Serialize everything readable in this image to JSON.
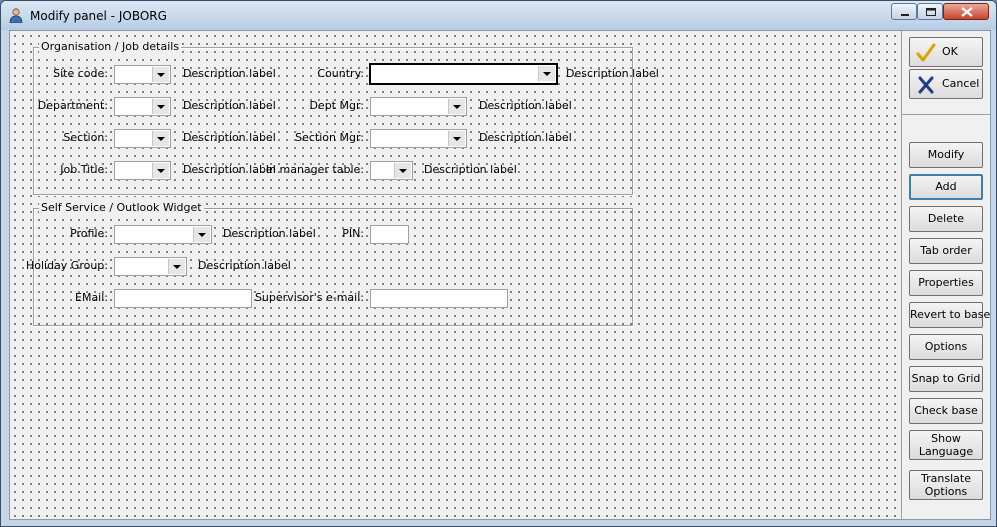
{
  "window": {
    "title": "Modify panel - JOBORG"
  },
  "groups": {
    "org": {
      "label": "Organisation / Job details"
    },
    "self": {
      "label": "Self Service / Outlook Widget"
    }
  },
  "org_fields": {
    "site_code": "Site code:",
    "country": "Country:",
    "department": "Department:",
    "dept_mgr": "Dept Mgr:",
    "section": "Section:",
    "section_mgr": "Section Mgr:",
    "job_title": "Job Title:",
    "in_manager_table": "In manager table:"
  },
  "self_fields": {
    "profile": "Profile:",
    "pin": "PIN:",
    "holiday_group": "Holiday Group:",
    "email": "EMail:",
    "supervisor_email": "Supervisor's e-mail:"
  },
  "description_label": "Description label",
  "buttons": {
    "ok": "OK",
    "cancel": "Cancel",
    "modify": "Modify",
    "add": "Add",
    "delete": "Delete",
    "tab_order": "Tab order",
    "properties": "Properties",
    "revert_to_base": "Revert to base",
    "options": "Options",
    "snap_to_grid": "Snap to Grid",
    "check_base": "Check base",
    "show_language_1": "Show",
    "show_language_2": "Language",
    "translate_options_1": "Translate",
    "translate_options_2": "Options"
  },
  "icons": {
    "ok": "checkmark-icon",
    "cancel": "x-icon",
    "app": "person-icon"
  },
  "colors": {
    "ok_check": "#d9a400",
    "cancel_x": "#1f3d8a",
    "default_button_border": "#3c7fb1"
  }
}
